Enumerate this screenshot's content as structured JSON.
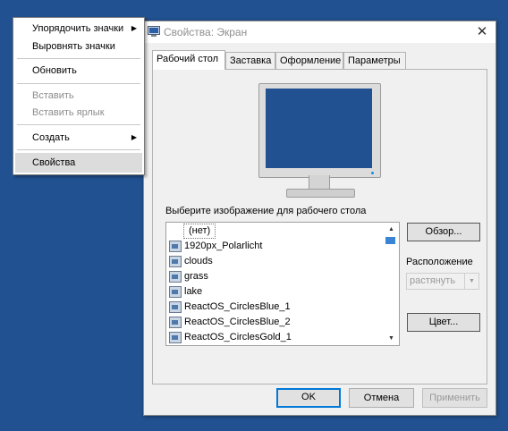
{
  "context_menu": {
    "items": [
      {
        "label": "Упорядочить значки",
        "submenu": true
      },
      {
        "label": "Выровнять значки"
      },
      {
        "label": "Обновить"
      },
      {
        "label": "Вставить",
        "disabled": true
      },
      {
        "label": "Вставить ярлык",
        "disabled": true
      },
      {
        "label": "Создать",
        "submenu": true
      },
      {
        "label": "Свойства",
        "selected": true
      }
    ]
  },
  "dialog": {
    "title": "Свойства: Экран",
    "close_glyph": "✕",
    "tabs": [
      "Рабочий стол",
      "Заставка",
      "Оформление",
      "Параметры"
    ],
    "active_tab": 0,
    "choose_label": "Выберите изображение для рабочего стола",
    "wallpapers": [
      "(нет)",
      "1920px_Polarlicht",
      "clouds",
      "grass",
      "lake",
      "ReactOS_CirclesBlue_1",
      "ReactOS_CirclesBlue_2",
      "ReactOS_CirclesGold_1"
    ],
    "selected_wallpaper": "(нет)",
    "browse_label": "Обзор...",
    "position_label": "Расположение",
    "position_value": "растянуть",
    "color_label": "Цвет...",
    "ok_label": "OK",
    "cancel_label": "Отмена",
    "apply_label": "Применить",
    "preview_color": "#215190"
  },
  "desktop_color": "#215190"
}
